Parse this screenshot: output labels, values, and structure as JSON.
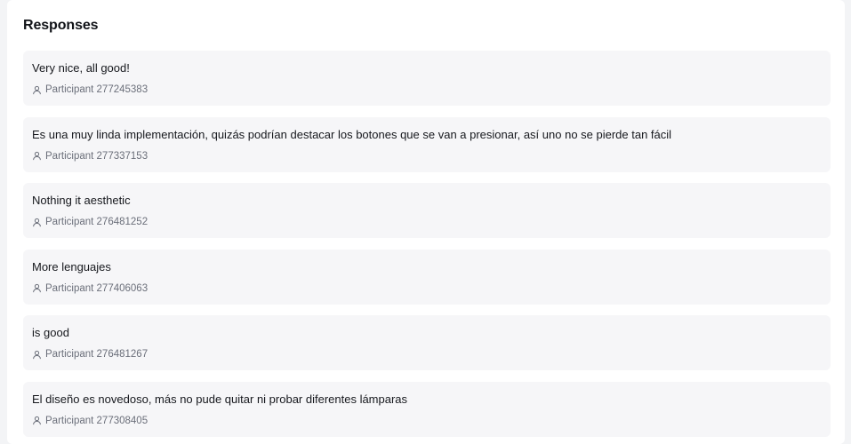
{
  "section": {
    "title": "Responses"
  },
  "responses": [
    {
      "text": "Very nice, all good!",
      "participant": "Participant 277245383"
    },
    {
      "text": "Es una muy linda implementación, quizás podrían destacar los botones que se van a presionar, así uno no se pierde tan fácil",
      "participant": "Participant 277337153"
    },
    {
      "text": "Nothing it aesthetic",
      "participant": "Participant 276481252"
    },
    {
      "text": "More lenguajes",
      "participant": "Participant 277406063"
    },
    {
      "text": "is good",
      "participant": "Participant 276481267"
    },
    {
      "text": "El diseño es novedoso, más no pude quitar ni probar diferentes lámparas",
      "participant": "Participant 277308405"
    }
  ],
  "icons": {
    "participant": "user-icon"
  },
  "colors": {
    "panel_bg": "#ffffff",
    "card_bg": "#f6f6f8",
    "text_primary": "#16181d",
    "text_secondary": "#6b6f7a"
  }
}
